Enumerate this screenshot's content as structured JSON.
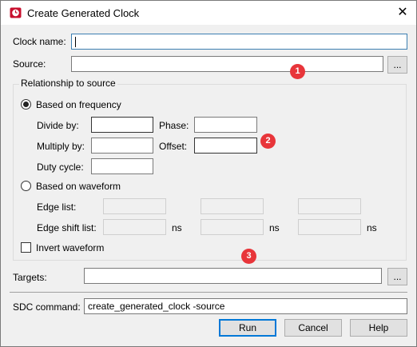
{
  "window": {
    "title": "Create Generated Clock",
    "close_glyph": "✕",
    "app_icon": "clock-icon"
  },
  "form": {
    "clock_name_label": "Clock name:",
    "clock_name_value": "",
    "source_label": "Source:",
    "source_value": "",
    "browse_label": "...",
    "relationship": {
      "legend": "Relationship to source",
      "frequency_option": "Based on frequency",
      "frequency_selected": true,
      "divide_by_label": "Divide by:",
      "divide_by_value": "",
      "phase_label": "Phase:",
      "phase_value": "",
      "multiply_by_label": "Multiply by:",
      "multiply_by_value": "",
      "offset_label": "Offset:",
      "offset_value": "",
      "duty_cycle_label": "Duty cycle:",
      "duty_cycle_value": "",
      "waveform_option": "Based on waveform",
      "waveform_selected": false,
      "edge_list_label": "Edge list:",
      "edge_shift_label": "Edge shift list:",
      "ns_unit": "ns",
      "invert_label": "Invert waveform",
      "invert_checked": false
    },
    "targets_label": "Targets:",
    "targets_value": "",
    "sdc_label": "SDC command:",
    "sdc_value": "create_generated_clock -source"
  },
  "buttons": {
    "run": "Run",
    "cancel": "Cancel",
    "help": "Help"
  },
  "markers": [
    "1",
    "2",
    "3"
  ],
  "colors": {
    "marker": "#e8353a",
    "focus_border": "#3c7fb1",
    "default_button_border": "#0078d7"
  }
}
